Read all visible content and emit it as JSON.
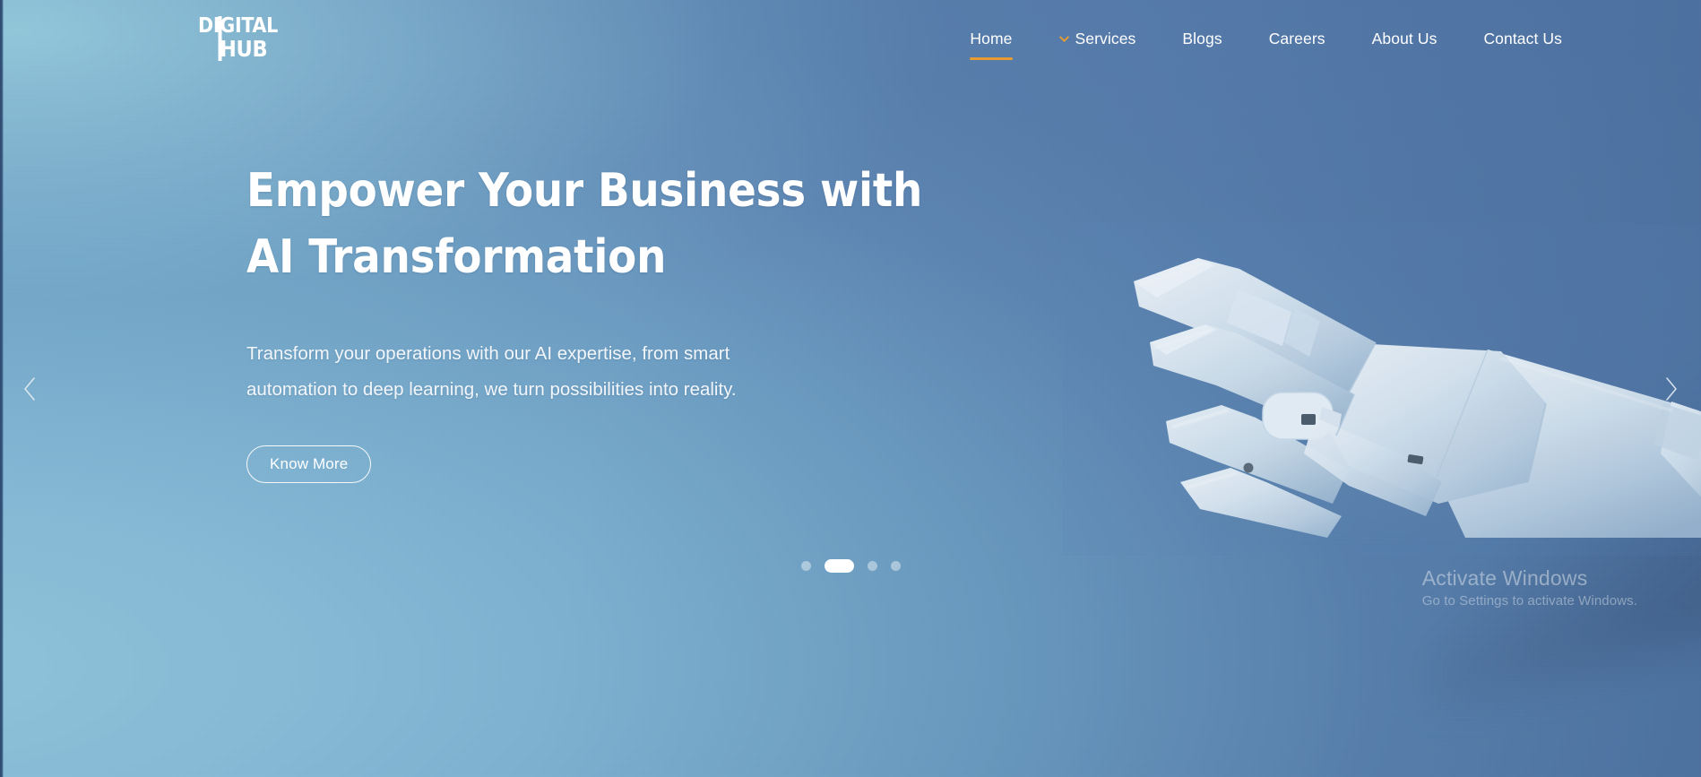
{
  "site": {
    "logo": {
      "line1": "DIGITAL",
      "line2": "HUB",
      "name": "digital-hub-logo"
    },
    "accent_color": "#E89B31",
    "text_color": "#FFFFFF",
    "background_colors": {
      "top_left": "#8FC4DA",
      "bottom_left": "#7FB6D2",
      "right": "#5A80AF",
      "left_edge_strip": "#2B4A6E"
    }
  },
  "nav": {
    "items": [
      {
        "label": "Home",
        "active": true,
        "has_dropdown": false
      },
      {
        "label": "Services",
        "active": false,
        "has_dropdown": true,
        "icon": "chevron-down-icon"
      },
      {
        "label": "Blogs",
        "active": false,
        "has_dropdown": false
      },
      {
        "label": "Careers",
        "active": false,
        "has_dropdown": false
      },
      {
        "label": "About Us",
        "active": false,
        "has_dropdown": false
      },
      {
        "label": "Contact Us",
        "active": false,
        "has_dropdown": false
      }
    ]
  },
  "hero": {
    "title": "Empower Your Business with AI Transformation",
    "subtitle_line1": "Transform your operations with our AI expertise, from smart",
    "subtitle_line2": "automation to deep learning, we turn possibilities into reality.",
    "cta_label": "Know More",
    "image_alt": "robotic-hand-pointing"
  },
  "carousel": {
    "prev_icon": "chevron-left-icon",
    "next_icon": "chevron-right-icon",
    "slide_count": 4,
    "active_slide": 2,
    "dots": [
      {
        "index": 1,
        "active": false
      },
      {
        "index": 2,
        "active": true
      },
      {
        "index": 3,
        "active": false
      },
      {
        "index": 4,
        "active": false
      }
    ]
  },
  "watermark": {
    "title": "Activate Windows",
    "subtitle": "Go to Settings to activate Windows."
  }
}
